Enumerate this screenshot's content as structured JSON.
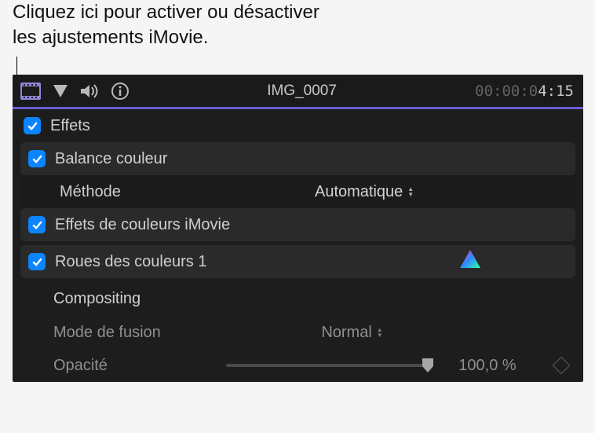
{
  "annotation": {
    "line1": "Cliquez ici pour activer ou désactiver",
    "line2": "les ajustements iMovie."
  },
  "toolbar": {
    "title": "IMG_0007",
    "timecode_inactive": "00:00:0",
    "timecode_active": "4:15"
  },
  "effects": {
    "section_label": "Effets",
    "color_balance": {
      "label": "Balance couleur",
      "method_label": "Méthode",
      "method_value": "Automatique"
    },
    "imovie_color_effects": {
      "label": "Effets de couleurs iMovie"
    },
    "color_wheels": {
      "label": "Roues des couleurs 1"
    }
  },
  "compositing": {
    "section_label": "Compositing",
    "blend_mode": {
      "label": "Mode de fusion",
      "value": "Normal"
    },
    "opacity": {
      "label": "Opacité",
      "value": "100,0 %",
      "slider_value": 100
    }
  },
  "icons": {
    "filmstrip": "filmstrip-icon",
    "marker": "marker-icon",
    "volume": "volume-icon",
    "info": "info-icon",
    "color_triangle": "color-triangle-icon",
    "keyframe": "keyframe-icon"
  }
}
